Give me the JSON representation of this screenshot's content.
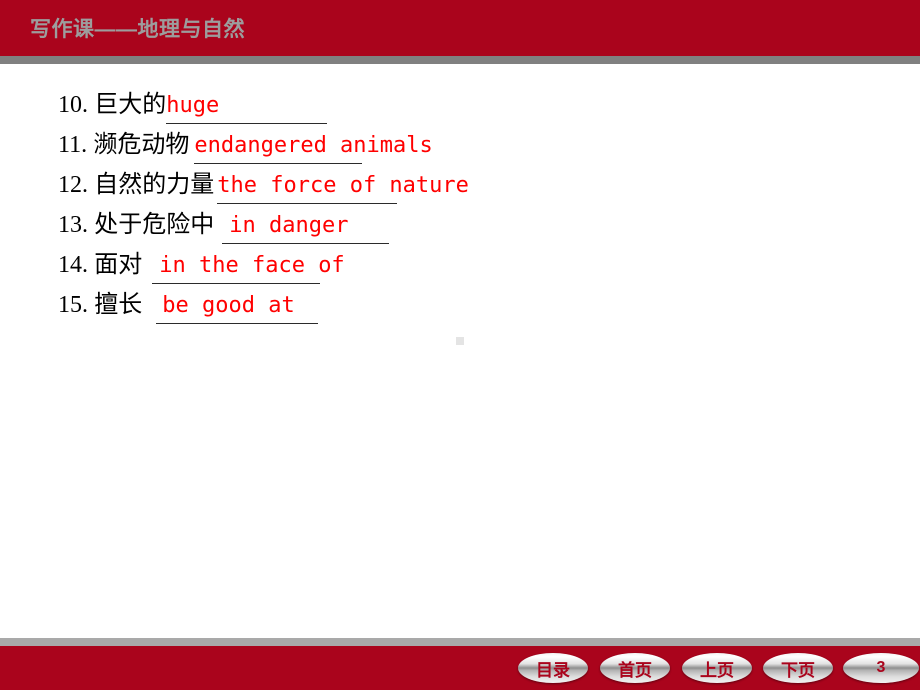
{
  "header": {
    "title": "写作课——地理与自然"
  },
  "content": {
    "items": [
      {
        "num": "10.",
        "cn": "巨大的",
        "answer": "huge"
      },
      {
        "num": "11.",
        "cn": "濒危动物",
        "answer": "endangered animals"
      },
      {
        "num": "12.",
        "cn": "自然的力量",
        "answer": "the force of nature"
      },
      {
        "num": "13.",
        "cn": "处于危险中",
        "answer": "in danger"
      },
      {
        "num": "14.",
        "cn": "面对",
        "answer": "in the face of"
      },
      {
        "num": "15.",
        "cn": "擅长",
        "answer": "be good at"
      }
    ]
  },
  "footer": {
    "contents_label": "目录",
    "home_label": "首页",
    "prev_label": "上页",
    "next_label": "下页",
    "page_number": "3"
  },
  "colors": {
    "brand_red": "#aa041c",
    "answer_red": "#ff0000",
    "title_gray": "#9d9d9d",
    "rule_gray_top": "#808080",
    "rule_gray_bottom": "#a9a9a9"
  }
}
